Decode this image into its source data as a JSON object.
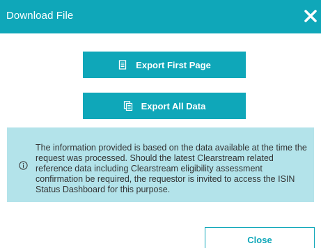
{
  "dialog": {
    "title": "Download File",
    "close_icon": "close-icon"
  },
  "buttons": {
    "export_first_label": "Export First Page",
    "export_first_icon": "document-icon",
    "export_all_label": "Export All Data",
    "export_all_icon": "documents-icon",
    "close_label": "Close"
  },
  "info": {
    "icon": "info-icon",
    "text": "The information provided is based on the data available at the time the request was processed. Should the latest Clearstream related reference data including Clearstream eligibility assessment confirmation be required, the requestor is invited to access the ISIN Status Dashboard for this purpose."
  },
  "colors": {
    "accent": "#0fa7b9",
    "info_background": "#b3e3ea",
    "text": "#333333"
  }
}
